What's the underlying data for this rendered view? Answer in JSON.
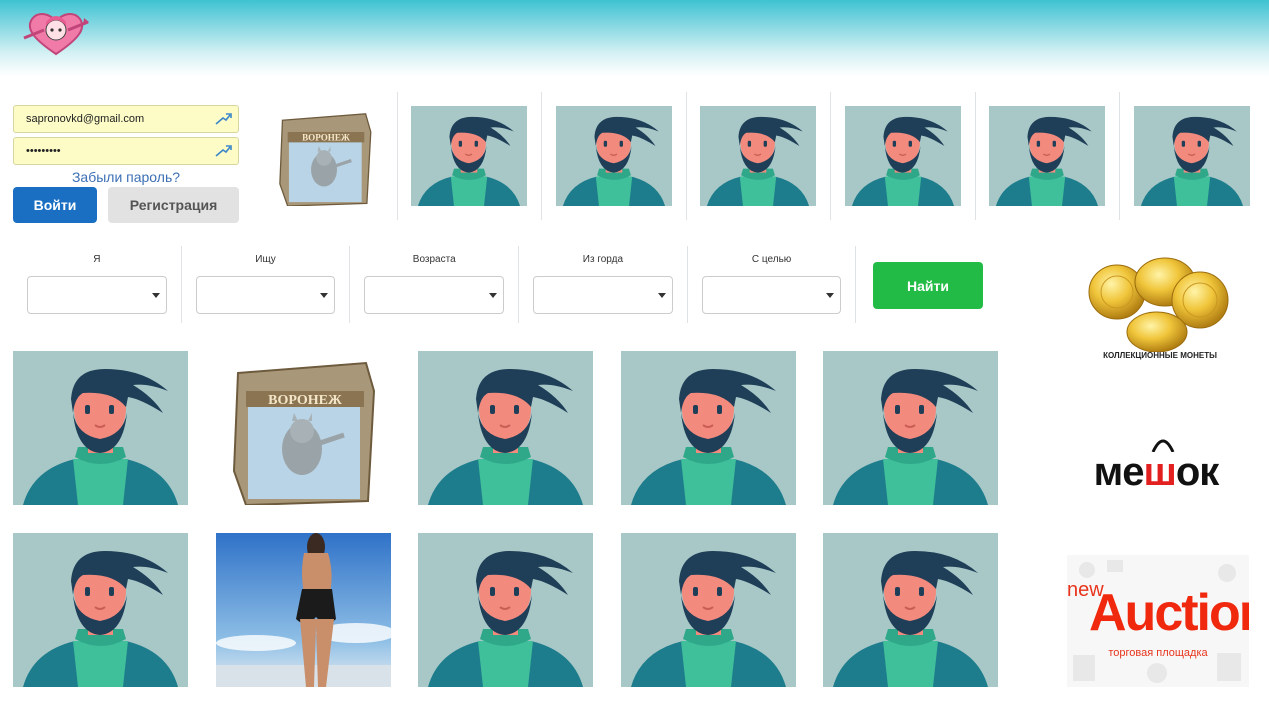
{
  "colors": {
    "header_top": "#3ec3d2",
    "login_button": "#1a6fc3",
    "find_button": "#22bb45",
    "avatar_bg": "#a8c8c8",
    "field_bg": "#fdfcc7",
    "link": "#3c6fb5"
  },
  "header": {
    "logo_icon": "heart-anime-logo-icon"
  },
  "login": {
    "email_value": "sapronovkd@gmail.com",
    "password_value": "•••••••••",
    "forgot_label": "Забыли пароль?",
    "login_label": "Войти",
    "register_label": "Регистрация",
    "autofill_icon": "key-autofill-icon"
  },
  "top_strip": [
    {
      "kind": "voronezh",
      "label": "ВОРОНЕЖ"
    },
    {
      "kind": "avatar"
    },
    {
      "kind": "avatar"
    },
    {
      "kind": "avatar"
    },
    {
      "kind": "avatar"
    },
    {
      "kind": "avatar"
    },
    {
      "kind": "avatar"
    }
  ],
  "search": {
    "filters": [
      {
        "label": "Я",
        "value": ""
      },
      {
        "label": "Ищу",
        "value": ""
      },
      {
        "label": "Возраста",
        "value": ""
      },
      {
        "label": "Из горда",
        "value": ""
      },
      {
        "label": "С целью",
        "value": ""
      }
    ],
    "find_label": "Найти"
  },
  "grid": [
    {
      "kind": "avatar"
    },
    {
      "kind": "voronezh",
      "label": "ВОРОНЕЖ"
    },
    {
      "kind": "avatar"
    },
    {
      "kind": "avatar"
    },
    {
      "kind": "avatar"
    },
    {
      "kind": "avatar"
    },
    {
      "kind": "beach-photo"
    },
    {
      "kind": "avatar"
    },
    {
      "kind": "avatar"
    },
    {
      "kind": "avatar"
    }
  ],
  "ads": {
    "coins_caption": "КОЛЛЕКЦИОННЫЕ МОНЕТЫ",
    "meshok_prefix": "ме",
    "meshok_highlight": "ш",
    "meshok_suffix": "ок",
    "auction_new": "new",
    "auction_main": "Auction",
    "auction_sub": "торговая площадка"
  }
}
